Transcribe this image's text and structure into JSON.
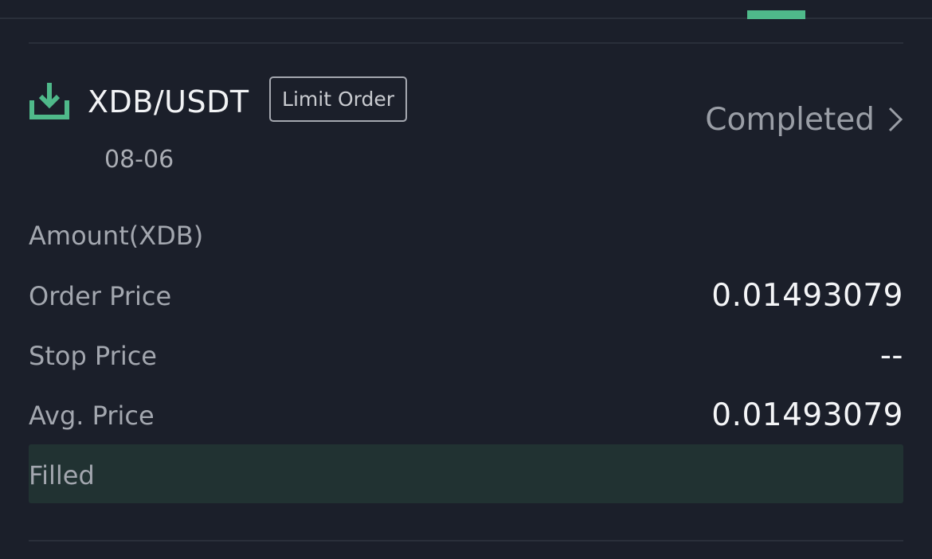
{
  "tab": {
    "indicator_color": "#4fb98a"
  },
  "order": {
    "icon": "download-icon",
    "pair": "XDB/USDT",
    "type": "Limit Order",
    "date": "08-06",
    "status": "Completed"
  },
  "details": {
    "amount_label": "Amount(XDB)",
    "order_price_label": "Order Price",
    "order_price_value": "0.01493079",
    "stop_price_label": "Stop Price",
    "stop_price_value": "--",
    "avg_price_label": "Avg. Price",
    "avg_price_value": "0.01493079",
    "filled_label": "Filled"
  },
  "colors": {
    "background": "#1b1f2a",
    "accent": "#4fb98a",
    "filled_bar": "#213232"
  }
}
